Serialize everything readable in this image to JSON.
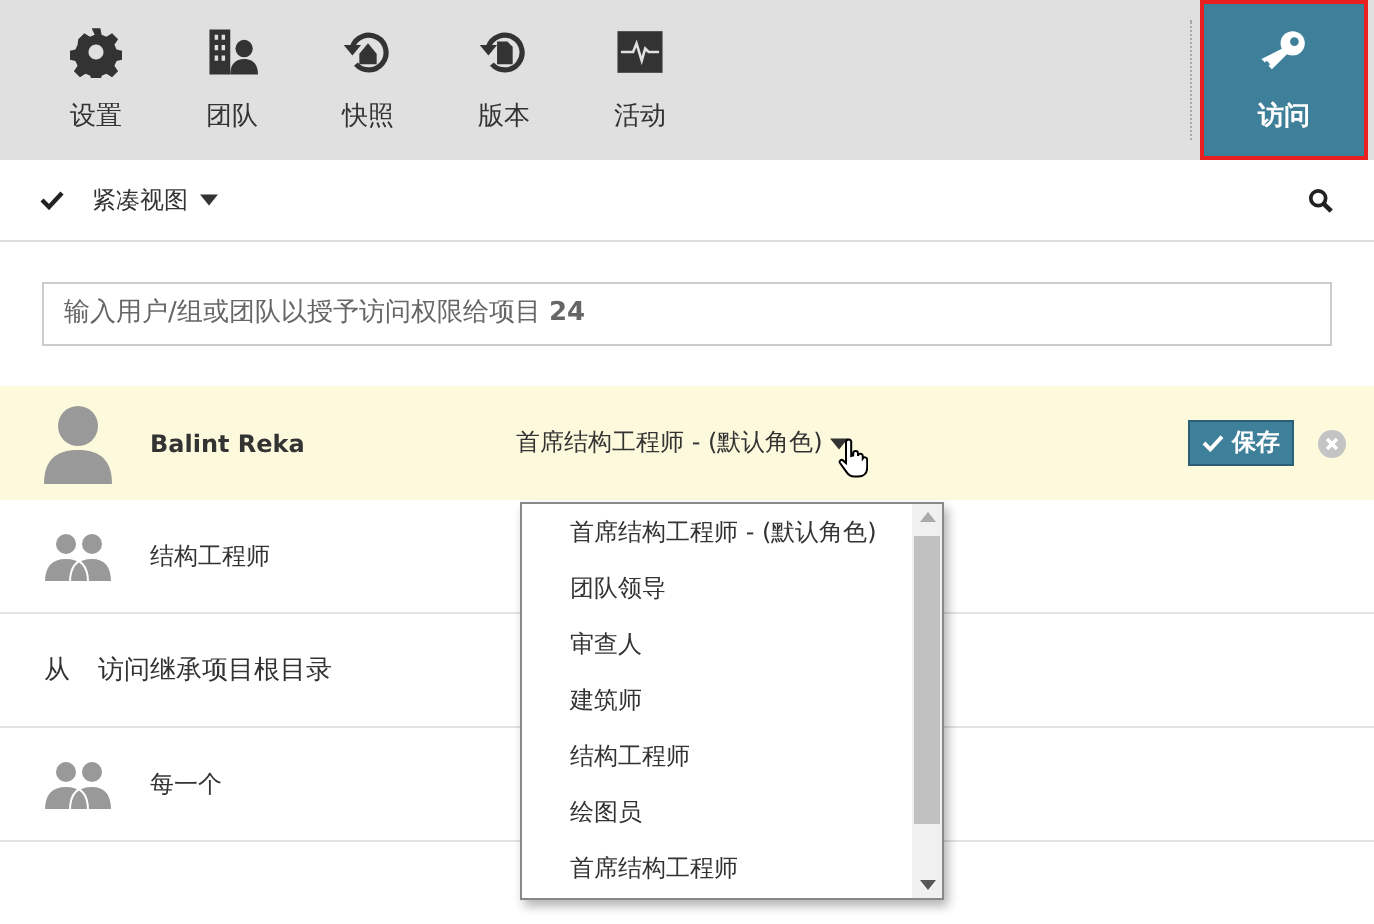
{
  "toolbar": {
    "tabs": [
      {
        "label": "设置",
        "selected": false
      },
      {
        "label": "团队",
        "selected": false
      },
      {
        "label": "快照",
        "selected": false
      },
      {
        "label": "版本",
        "selected": false
      },
      {
        "label": "活动",
        "selected": false
      },
      {
        "label": "访问",
        "selected": true
      }
    ]
  },
  "view_bar": {
    "checked": true,
    "label": "紧凑视图"
  },
  "search": {
    "placeholder": "输入用户/组或团队以授予访问权限给项目 **24**"
  },
  "rows": [
    {
      "kind": "user",
      "name": "Balint Reka",
      "role": "首席结构工程师 - (默认角色)",
      "save": "保存",
      "editing": true
    },
    {
      "kind": "group",
      "name": "结构工程师",
      "editing": false
    },
    {
      "kind": "inherit",
      "prefix": "从",
      "name": "访问继承项目根目录"
    },
    {
      "kind": "group",
      "name": "每一个",
      "editing": false
    }
  ],
  "dropdown": {
    "options": [
      "首席结构工程师 - (默认角色)",
      "团队领导",
      "审查人",
      "建筑师",
      "结构工程师",
      "绘图员",
      "首席结构工程师"
    ]
  }
}
